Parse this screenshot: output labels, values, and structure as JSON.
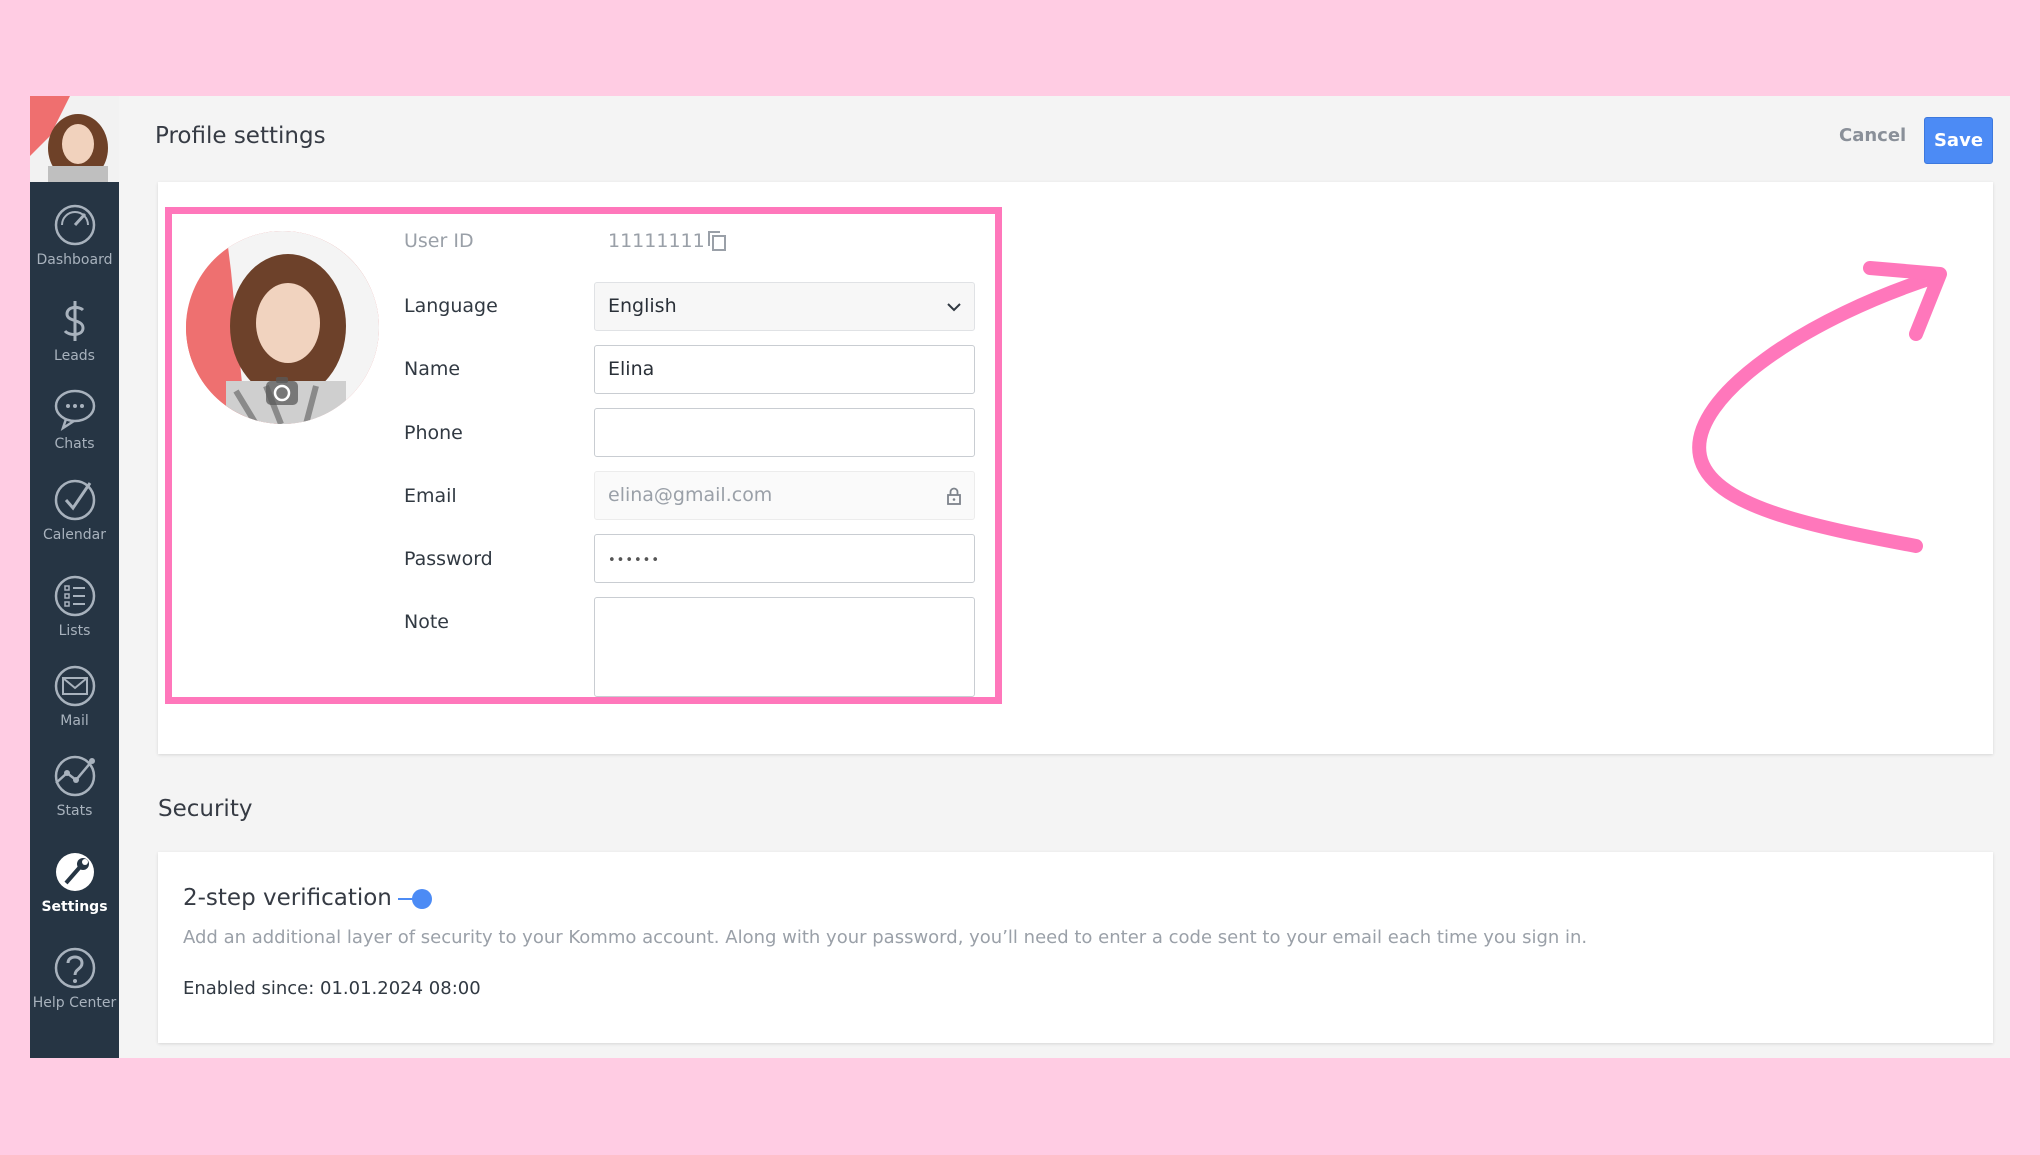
{
  "sidebar": {
    "items": [
      {
        "label": "Dashboard",
        "icon": "dashboard-icon"
      },
      {
        "label": "Leads",
        "icon": "dollar-icon"
      },
      {
        "label": "Chats",
        "icon": "chat-icon"
      },
      {
        "label": "Calendar",
        "icon": "checkmark-icon"
      },
      {
        "label": "Lists",
        "icon": "list-icon"
      },
      {
        "label": "Mail",
        "icon": "mail-icon"
      },
      {
        "label": "Stats",
        "icon": "stats-icon"
      },
      {
        "label": "Settings",
        "icon": "wrench-icon",
        "active": true
      },
      {
        "label": "Help Center",
        "icon": "help-icon"
      }
    ]
  },
  "header": {
    "title": "Profile settings",
    "cancel_label": "Cancel",
    "save_label": "Save"
  },
  "profile": {
    "user_id_label": "User ID",
    "user_id_value": "11111111",
    "language_label": "Language",
    "language_value": "English",
    "name_label": "Name",
    "name_value": "Elina",
    "phone_label": "Phone",
    "phone_value": "",
    "email_label": "Email",
    "email_value": "elina@gmail.com",
    "password_label": "Password",
    "password_value": "••••••",
    "note_label": "Note",
    "note_value": ""
  },
  "security": {
    "title": "Security",
    "twofa_title": "2-step verification",
    "twofa_enabled": true,
    "twofa_description": "Add an additional layer of security to your Kommo account. Along with your password, you’ll need to enter a code sent to your email each time you sign in.",
    "enabled_since": "Enabled since: 01.01.2024 08:00"
  },
  "colors": {
    "page_background": "#ffcce3",
    "sidebar": "#263544",
    "accent": "#4c8bf5",
    "highlight": "#ff77bb"
  }
}
